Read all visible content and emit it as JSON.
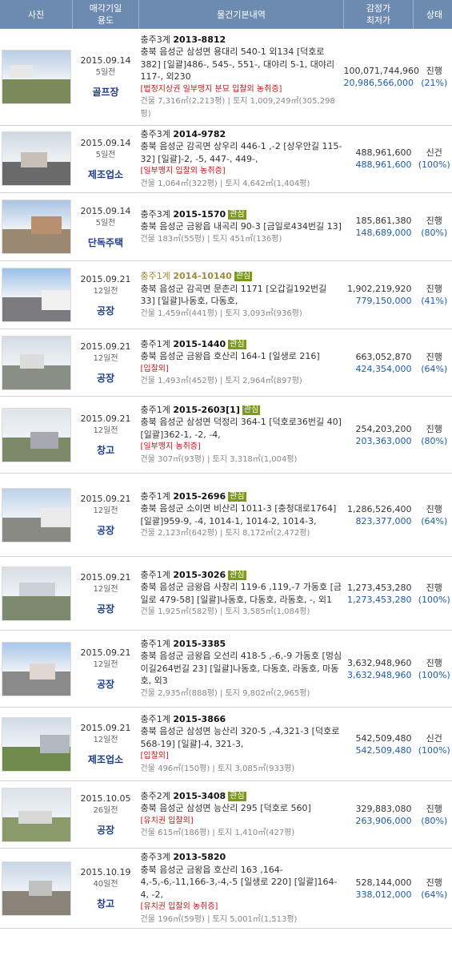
{
  "header": {
    "photo": "사진",
    "date_line1": "매각기일",
    "date_line2": "용도",
    "desc": "물건기본내역",
    "price_line1": "감정가",
    "price_line2": "최저가",
    "status": "상태"
  },
  "rows": [
    {
      "date": "2015.09.14",
      "days": "5일전",
      "usage": "골프장",
      "court": "충주3계",
      "caseno": "2013-8812",
      "badge": "",
      "addr": "충북 음성군 삼성면 용대리 540-1 외134 [덕호로 382] [일괄]486-, 545-, 551-, 대야리 5-1, 대야리 117-, 외230",
      "tags": "[법정지상권  일부맹지 분묘  입찰외  농취증]",
      "area": "건물 7,316㎡(2,213평) | 토지 1,009,249㎡(305,298평)",
      "appraisal": "100,071,744,960",
      "minimum": "20,986,566,000",
      "status": "진행",
      "pct": "(21%)"
    },
    {
      "date": "2015.09.14",
      "days": "5일전",
      "usage": "제조업소",
      "court": "충주3계",
      "caseno": "2014-9782",
      "badge": "",
      "addr": "충북 음성군 감곡면 상우리 446-1 ,-2 [상우안길 115-32] [일괄]-2, -5, 447-, 449-,",
      "tags": "[일부맹지 입찰외  농취증]",
      "area": "건물 1,064㎡(322평) | 토지 4,642㎡(1,404평)",
      "appraisal": "488,961,600",
      "minimum": "488,961,600",
      "status": "신건",
      "pct": "(100%)"
    },
    {
      "date": "2015.09.14",
      "days": "5일전",
      "usage": "단독주택",
      "court": "충주3계",
      "caseno": "2015-1570",
      "badge": "관심",
      "addr": "충북 음성군 금왕읍 내곡리 90-3 [금일로434번길 13]",
      "tags": "",
      "area": "건물 183㎡(55평) | 토지 451㎡(136평)",
      "appraisal": "185,861,380",
      "minimum": "148,689,000",
      "status": "진행",
      "pct": "(80%)"
    },
    {
      "date": "2015.09.21",
      "days": "12일전",
      "usage": "공장",
      "court": "충주1계",
      "caseno": "2014-10140",
      "badge": "관심",
      "old": true,
      "addr": "충북 음성군 감곡면 문촌리 1171 [오갑길192번길 33] [일괄]나동호, 다동호,",
      "tags": "",
      "area": "건물 1,459㎡(441평) | 토지 3,093㎡(936평)",
      "appraisal": "1,902,219,920",
      "minimum": "779,150,000",
      "status": "진행",
      "pct": "(41%)"
    },
    {
      "date": "2015.09.21",
      "days": "12일전",
      "usage": "공장",
      "court": "충주1계",
      "caseno": "2015-1440",
      "badge": "관심",
      "addr": "충북 음성군 금왕읍 호산리 164-1 [일생로 216]",
      "tags": "[입찰외]",
      "area": "건물 1,493㎡(452평) | 토지 2,964㎡(897평)",
      "appraisal": "663,052,870",
      "minimum": "424,354,000",
      "status": "진행",
      "pct": "(64%)"
    },
    {
      "date": "2015.09.21",
      "days": "12일전",
      "usage": "창고",
      "court": "충주1계",
      "caseno": "2015-2603[1]",
      "badge": "관심",
      "addr": "충북 음성군 삼성면 덕정리 364-1 [덕호로36번길 40] [일괄]362-1, -2, -4,",
      "tags": "[일부맹지 농취증]",
      "area": "건물 307㎡(93평) | 토지 3,318㎡(1,004평)",
      "appraisal": "254,203,200",
      "minimum": "203,363,000",
      "status": "진행",
      "pct": "(80%)"
    },
    {
      "date": "2015.09.21",
      "days": "12일전",
      "usage": "공장",
      "court": "충주1계",
      "caseno": "2015-2696",
      "badge": "관심",
      "addr": "충북 음성군 소이면 비산리 1011-3 [충청대로1764] [일괄]959-9, -4, 1014-1, 1014-2, 1014-3,",
      "tags": "",
      "area": "건물 2,123㎡(642평) | 토지 8,172㎡(2,472평)",
      "appraisal": "1,286,526,400",
      "minimum": "823,377,000",
      "status": "진행",
      "pct": "(64%)"
    },
    {
      "date": "2015.09.21",
      "days": "12일전",
      "usage": "공장",
      "court": "충주1계",
      "caseno": "2015-3026",
      "badge": "관심",
      "addr": "충북 음성군 금왕읍 사창리 119-6 ,119,-7 가동호 [금일로 479-58] [일괄]나동호, 다동호, 라동호, -, 외1",
      "tags": "",
      "area": "건물 1,925㎡(582평) | 토지 3,585㎡(1,084평)",
      "appraisal": "1,273,453,280",
      "minimum": "1,273,453,280",
      "status": "진행",
      "pct": "(100%)"
    },
    {
      "date": "2015.09.21",
      "days": "12일전",
      "usage": "공장",
      "court": "충주1계",
      "caseno": "2015-3385",
      "badge": "",
      "addr": "충북 음성군 금왕읍 오선리 418-5 ,-6,-9 가동호 [멍심이길264번길 23] [일괄]나동호, 다동호, 라동호, 마동호, 외3",
      "tags": "",
      "area": "건물 2,935㎡(888평) | 토지 9,802㎡(2,965평)",
      "appraisal": "3,632,948,960",
      "minimum": "3,632,948,960",
      "status": "진행",
      "pct": "(100%)"
    },
    {
      "date": "2015.09.21",
      "days": "12일전",
      "usage": "제조업소",
      "court": "충주1계",
      "caseno": "2015-3866",
      "badge": "",
      "addr": "충북 음성군 삼성면 능산리 320-5 ,-4,321-3 [덕호로 568-19] [일괄]-4, 321-3,",
      "tags": "[입찰외]",
      "area": "건물 496㎡(150평) | 토지 3,085㎡(933평)",
      "appraisal": "542,509,480",
      "minimum": "542,509,480",
      "status": "신건",
      "pct": "(100%)"
    },
    {
      "date": "2015.10.05",
      "days": "26일전",
      "usage": "공장",
      "court": "충주2계",
      "caseno": "2015-3408",
      "badge": "관심",
      "addr": "충북 음성군 삼성면 능산리 295 [덕호로 560]",
      "tags": "[유치권  입찰외]",
      "area": "건물 615㎡(186평) | 토지 1,410㎡(427평)",
      "appraisal": "329,883,080",
      "minimum": "263,906,000",
      "status": "진행",
      "pct": "(80%)"
    },
    {
      "date": "2015.10.19",
      "days": "40일전",
      "usage": "창고",
      "court": "충주3계",
      "caseno": "2013-5820",
      "badge": "",
      "addr": "충북 음성군 금왕읍 호산리 163 ,164-4,-5,-6,-11,166-3,-4,-5 [일생로 220] [일괄]164-4, -2,",
      "tags": "[유치권  입찰외  농취증]",
      "area": "건물 196㎡(59평) | 토지 5,001㎡(1,513평)",
      "appraisal": "528,144,000",
      "minimum": "338,012,000",
      "status": "진행",
      "pct": "(64%)"
    }
  ],
  "thumbs": [
    {
      "sky": "#b9cde6",
      "ground": "#7a8a5a"
    },
    {
      "sky": "#cfd8e2",
      "ground": "#6a6a6a"
    },
    {
      "sky": "#a9c4e4",
      "ground": "#9a8870"
    },
    {
      "sky": "#9cc0ea",
      "ground": "#7c7c80"
    },
    {
      "sky": "#d4dbe3",
      "ground": "#8a8f86"
    },
    {
      "sky": "#dfe4ea",
      "ground": "#7d8a6a"
    },
    {
      "sky": "#bcd2ea",
      "ground": "#8a8a84"
    },
    {
      "sky": "#d9dee5",
      "ground": "#7c8a70"
    },
    {
      "sky": "#a8c6ea",
      "ground": "#8a8a8a"
    },
    {
      "sky": "#d2dce6",
      "ground": "#6f8a4c"
    },
    {
      "sky": "#dce2e8",
      "ground": "#8a9a6a"
    },
    {
      "sky": "#c8d6e6",
      "ground": "#8a8478"
    }
  ]
}
